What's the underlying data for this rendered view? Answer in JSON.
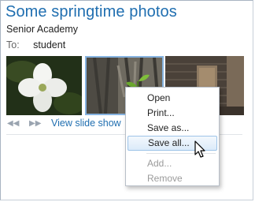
{
  "header": {
    "title": "Some springtime photos",
    "subtitle": "Senior Academy"
  },
  "recipient": {
    "label": "To:",
    "value": "student"
  },
  "photos": [
    {
      "name": "white-dogwood-flower"
    },
    {
      "name": "tree-bark-sprout"
    },
    {
      "name": "wooden-shed"
    }
  ],
  "controls": {
    "prev_icon": "◀◀",
    "next_icon": "▶▶",
    "slideshow_label": "View slide show"
  },
  "context_menu": {
    "items": [
      {
        "label": "Open",
        "state": "normal"
      },
      {
        "label": "Print...",
        "state": "normal"
      },
      {
        "label": "Save as...",
        "state": "normal"
      },
      {
        "label": "Save all...",
        "state": "hover"
      },
      {
        "label": "Add...",
        "state": "disabled"
      },
      {
        "label": "Remove",
        "state": "disabled"
      }
    ]
  },
  "colors": {
    "title": "#1f6eb0",
    "link": "#1f6eb0",
    "selection_border": "#86b3e0",
    "menu_hover": "#dbeaf9"
  }
}
